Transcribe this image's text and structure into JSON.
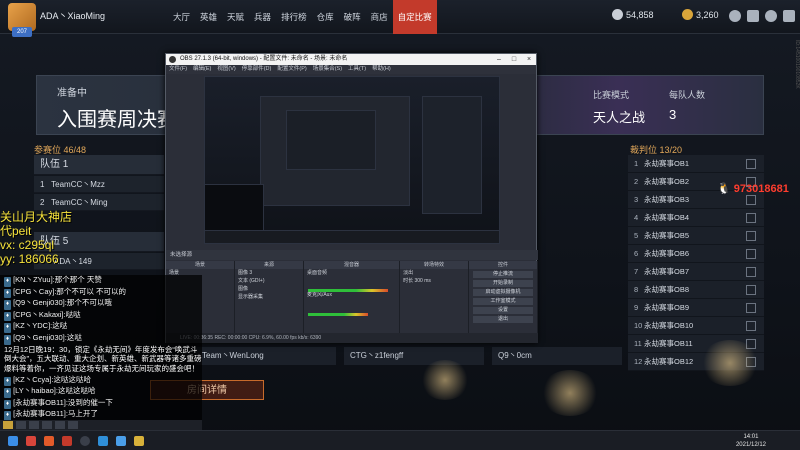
{
  "user": {
    "name": "ADA丶XiaoMing",
    "level": "207"
  },
  "nav": [
    "大厅",
    "英雄",
    "天赋",
    "兵器",
    "排行榜",
    "仓库",
    "破阵",
    "商店",
    "自定比赛"
  ],
  "currency": {
    "silver": "54,858",
    "gold": "3,260"
  },
  "banner": {
    "status": "准备中",
    "title": "入围赛周决赛",
    "mode_label": "比赛模式",
    "mode_value": "天人之战",
    "per_team_label": "每队人数",
    "per_team_value": "3"
  },
  "slots": "参赛位 46/48",
  "judges": "裁判位 13/20",
  "teams": [
    {
      "header": "队伍 1",
      "rows": [
        {
          "n": "1",
          "name": "TeamCC丶Mzz"
        },
        {
          "n": "2",
          "name": "TeamCC丶Ming"
        }
      ]
    },
    {
      "header": "队伍 5",
      "rows": [
        {
          "n": "",
          "name": "ADA丶149"
        }
      ]
    }
  ],
  "judge_list": [
    "永劫赛事OB1",
    "永劫赛事OB2",
    "永劫赛事OB3",
    "永劫赛事OB4",
    "永劫赛事OB5",
    "永劫赛事OB6",
    "永劫赛事OB7",
    "永劫赛事OB8",
    "永劫赛事OB9",
    "永劫赛事OB10",
    "永劫赛事OB11",
    "永劫赛事OB12"
  ],
  "bottom_rows": [
    "Team丶WenLong",
    "CTG丶z1fengff",
    "Q9丶0cm"
  ],
  "detail_button": "房间详情",
  "obs": {
    "title": "OBS 27.1.3 (64-bit, windows) - 配置文件: 未命名 - 场景: 未命名",
    "menu": [
      "文件(F)",
      "编辑(E)",
      "视图(V)",
      "停靠部件(D)",
      "配置文件(P)",
      "场景集合(S)",
      "工具(T)",
      "帮助(H)"
    ],
    "context": "未选择源",
    "docks": {
      "scenes": {
        "title": "场景",
        "items": [
          "场景"
        ]
      },
      "sources": {
        "title": "来源",
        "items": [
          "图像 3",
          "文本 (GDI+)",
          "图像",
          "显示器采集"
        ]
      },
      "mixer": {
        "title": "混音器",
        "items": [
          "桌面音频",
          "麦克风/Aux"
        ]
      },
      "transitions": {
        "title": "转场特效",
        "items": [
          "淡出",
          "时长 300 ms"
        ]
      },
      "controls": {
        "title": "控件",
        "items": [
          "停止推流",
          "开始录制",
          "启动虚拟摄像机",
          "工作室模式",
          "设置",
          "退出"
        ]
      }
    },
    "status": "LIVE: 00:36:35   REC: 00:00:00   CPU: 6.9%, 60.00 fps   kb/s: 6390"
  },
  "chat": [
    {
      "badge": "",
      "text": "[KN丶ZYuu]:那个那个 天赞"
    },
    {
      "badge": "",
      "text": "[CPG丶Cay]:那个不可以 不可以的"
    },
    {
      "badge": "",
      "text": "[Q9丶Genji030]:那个不可以哦"
    },
    {
      "badge": "",
      "text": "[CPG丶Kakaxi]:哒哒"
    },
    {
      "badge": "",
      "text": "[KZ丶YDC]:这哒"
    },
    {
      "badge": "",
      "text": "[Q9丶Genji030]:这哒"
    },
    {
      "badge": "note",
      "text": "12月12日晚19：30，锁定《永劫无间》年度发布会“唤武斗倒大会”，五大联动、重大企划、新英雄、新武器等诸多重磅爆料等着你，一齐见证这场专属于永劫无间玩家的盛会吧！"
    },
    {
      "badge": "",
      "text": "[KZ丶Ccya]:这哒这哒哈"
    },
    {
      "badge": "",
      "text": "[LY丶haibao]:这哒这哒哈"
    },
    {
      "badge": "",
      "text": "[永劫赛事OB11]:没到的催一下"
    },
    {
      "badge": "",
      "text": "[永劫赛事OB11]:马上开了"
    }
  ],
  "overlay": {
    "line1": "关山月大神店",
    "line2": "代peit",
    "line3": "vx: c295ql",
    "line4": "yy: 186066"
  },
  "qq": "973018681",
  "clock": {
    "time": "14:01",
    "date": "2021/12/12"
  }
}
